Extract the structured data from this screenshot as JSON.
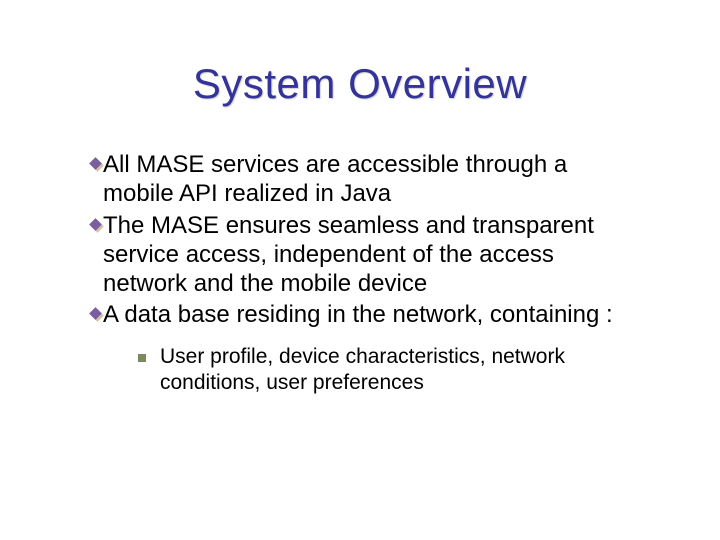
{
  "title": "System Overview",
  "bullets": [
    "All MASE services are accessible through a mobile API realized in Java",
    "The MASE ensures seamless and transparent service access, independent of the access network and the mobile device",
    "A data base residing in the network, containing :"
  ],
  "sub_bullets": [
    "User profile, device characteristics, network conditions, user preferences"
  ]
}
